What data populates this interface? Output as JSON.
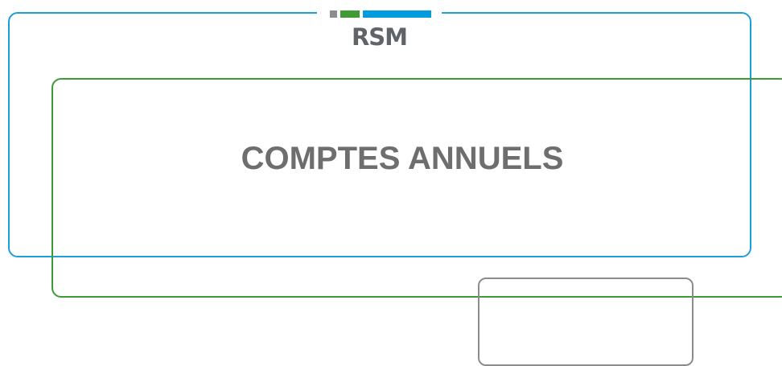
{
  "logo": {
    "text": "RSM",
    "bar_colors": {
      "gray": "#8a8e91",
      "green": "#3f9c35",
      "blue": "#009cde"
    }
  },
  "document": {
    "title": "COMPTES ANNUELS"
  },
  "frame_colors": {
    "blue": "#1a9fd9",
    "green": "#3d9b35",
    "gray": "#8c8c8c"
  }
}
